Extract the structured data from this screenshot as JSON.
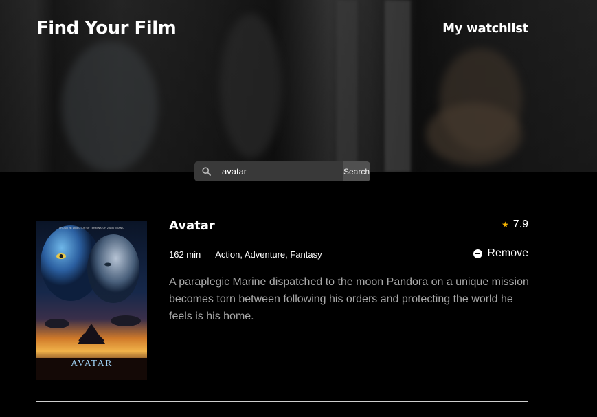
{
  "header": {
    "brand": "Find Your Film",
    "watchlist_link": "My watchlist"
  },
  "search": {
    "value": "avatar",
    "button_label": "Search"
  },
  "results": [
    {
      "title": "Avatar",
      "rating": "7.9",
      "runtime": "162 min",
      "genres": "Action, Adventure, Fantasy",
      "action_label": "Remove",
      "plot": "A paraplegic Marine dispatched to the moon Pandora on a unique mission becomes torn between following his orders and protecting the world he feels is his home.",
      "poster": {
        "tagline": "FROM THE DIRECTOR OF TERMINATOR 2 AND TITANIC",
        "title": "AVATAR"
      }
    }
  ],
  "colors": {
    "background": "#000000",
    "star": "#f5b301",
    "plot_text": "#a9a9a9",
    "search_field": "#393939",
    "search_button": "#505050"
  }
}
